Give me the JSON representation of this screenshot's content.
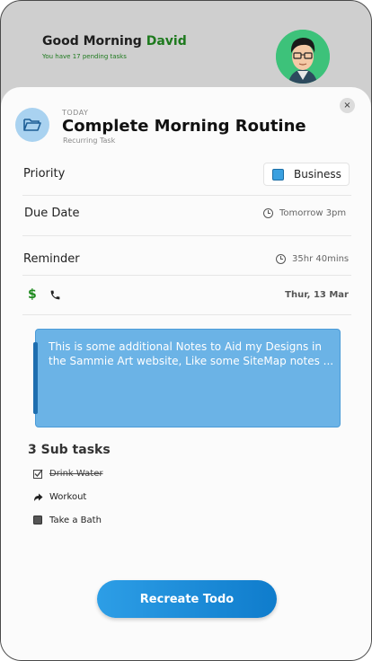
{
  "header": {
    "greeting": "Good Morning",
    "user_name": "David",
    "pending_text": "You have 17 pending tasks"
  },
  "task": {
    "overline": "TODAY",
    "title": "Complete Morning Routine",
    "subtitle": "Recurring Task",
    "folder_icon": "folder-open-icon"
  },
  "details": {
    "priority_label": "Priority",
    "priority_value": "Business",
    "priority_color": "#3aa0e0",
    "due_label": "Due Date",
    "due_value": "Tomorrow 3pm",
    "reminder_label": "Reminder",
    "reminder_value": "35hr 40mins",
    "date_value": "Thur, 13 Mar",
    "dollar_icon": "$",
    "phone_icon": "phone-icon"
  },
  "notes": {
    "text": "This is some additional Notes to Aid my Designs in the Sammie Art website, Like some SiteMap notes ...",
    "background": "#6bb3e6"
  },
  "subtasks": {
    "heading": "3 Sub tasks",
    "items": [
      {
        "label": "Drink Water",
        "state": "done",
        "icon": "checked-box-icon"
      },
      {
        "label": "Workout",
        "state": "in-progress",
        "icon": "forward-arrow-icon"
      },
      {
        "label": "Take a Bath",
        "state": "pending",
        "icon": "filled-box-icon"
      }
    ]
  },
  "actions": {
    "recreate_label": "Recreate Todo",
    "close_symbol": "×"
  },
  "colors": {
    "accent_green": "#1e7a1e",
    "accent_blue": "#1e8ad8"
  }
}
